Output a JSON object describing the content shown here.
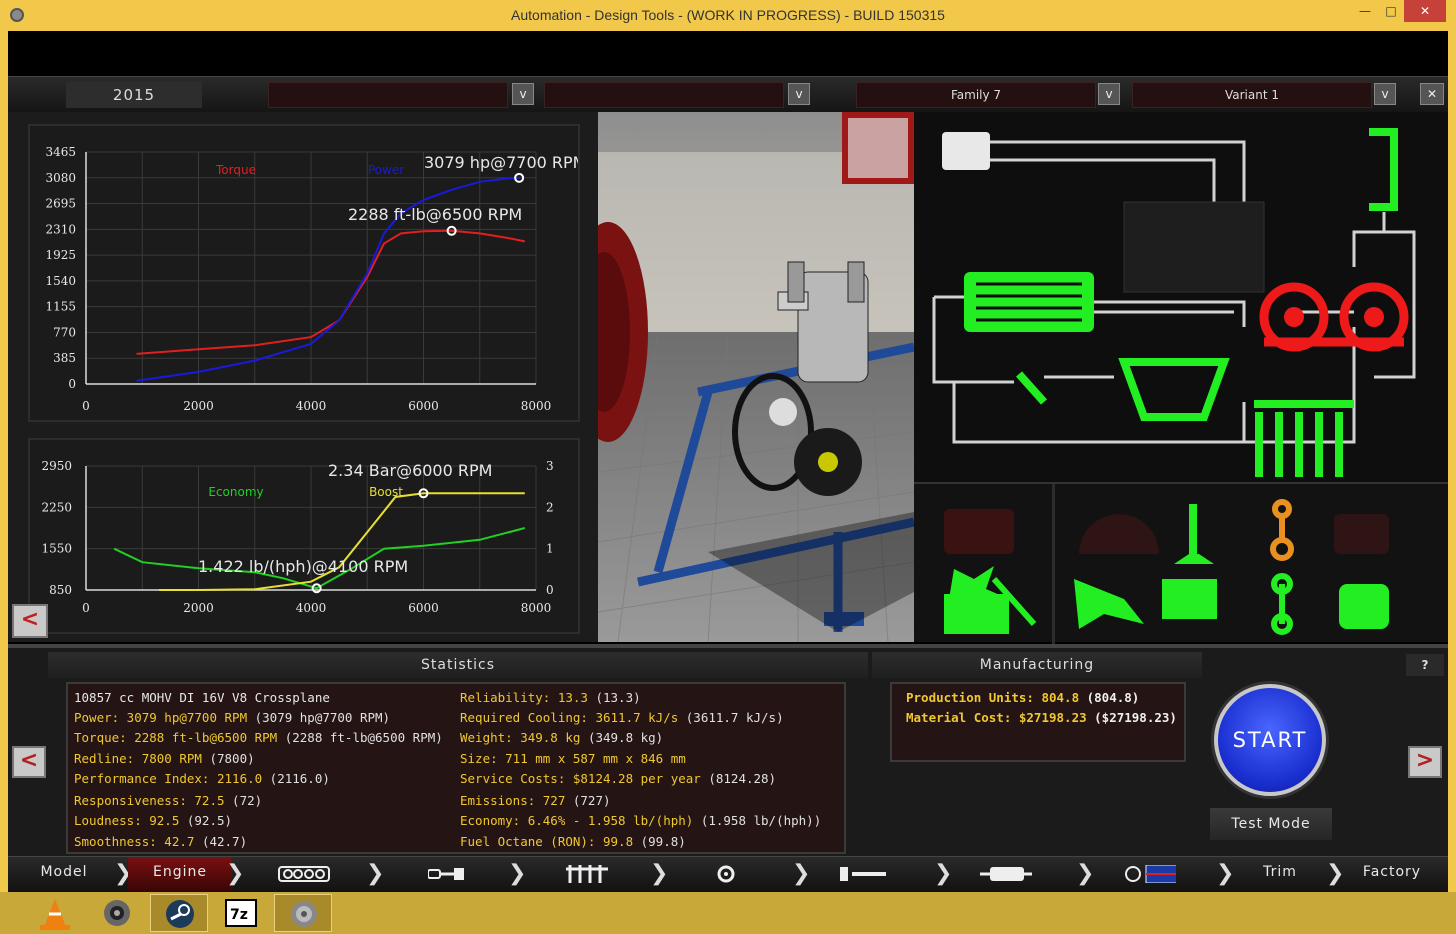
{
  "window": {
    "title": "Automation - Design Tools - (WORK IN PROGRESS) - BUILD 150315",
    "min": "—",
    "max": "□",
    "close": "✕"
  },
  "topbar": {
    "year": "2015",
    "dropdown1": "",
    "dropdown2": "",
    "family": "Family 7",
    "variant": "Variant 1",
    "dd_glyph": "v",
    "close_glyph": "✕"
  },
  "graph_top": {
    "yticks": [
      "3465",
      "3080",
      "2695",
      "2310",
      "1925",
      "1540",
      "1155",
      "770",
      "385",
      "0"
    ],
    "xticks": [
      "0",
      "2000",
      "4000",
      "6000",
      "8000"
    ],
    "torque_label": "Torque",
    "power_label": "Power",
    "power_peak": "3079 hp@7700 RPM",
    "torque_peak": "2288 ft-lb@6500 RPM"
  },
  "graph_bottom": {
    "yticks_left": [
      "2950",
      "2250",
      "1550",
      "850"
    ],
    "yticks_right": [
      "3",
      "2",
      "1",
      "0"
    ],
    "xticks": [
      "0",
      "2000",
      "4000",
      "6000",
      "8000"
    ],
    "economy_label": "Economy",
    "boost_label": "Boost",
    "boost_peak": "2.34 Bar@6000 RPM",
    "economy_min": "1.422 lb/(hph)@4100 RPM"
  },
  "chart_data": [
    {
      "type": "line",
      "xlim": [
        0,
        8000
      ],
      "ylim": [
        0,
        3465
      ],
      "series": [
        {
          "name": "Torque",
          "color": "#e02020",
          "x": [
            900,
            2000,
            3000,
            4000,
            4500,
            5000,
            5300,
            5600,
            6000,
            6500,
            7000,
            7500,
            7800
          ],
          "values": [
            450,
            520,
            580,
            700,
            950,
            1600,
            2100,
            2250,
            2280,
            2288,
            2250,
            2180,
            2130
          ]
        },
        {
          "name": "Power",
          "color": "#1a1adc",
          "x": [
            900,
            2000,
            3000,
            4000,
            4500,
            5000,
            5300,
            5600,
            6000,
            6500,
            7000,
            7500,
            7700
          ],
          "values": [
            50,
            180,
            350,
            600,
            950,
            1650,
            2250,
            2550,
            2750,
            2900,
            3020,
            3070,
            3079
          ]
        }
      ]
    },
    {
      "type": "line",
      "xlim": [
        0,
        8000
      ],
      "ylim_left": [
        850,
        2950
      ],
      "ylim_right": [
        0,
        3
      ],
      "series": [
        {
          "name": "Economy",
          "color": "#22d022",
          "axis": "left",
          "x": [
            500,
            1000,
            2000,
            3000,
            3500,
            4100,
            4700,
            5300,
            6000,
            7000,
            7800
          ],
          "values": [
            1550,
            1320,
            1220,
            1150,
            1050,
            880,
            1200,
            1550,
            1600,
            1700,
            1900
          ]
        },
        {
          "name": "Boost",
          "color": "#e8e030",
          "axis": "right",
          "x": [
            1300,
            2000,
            3000,
            4000,
            4500,
            5000,
            5500,
            6000,
            7000,
            7800
          ],
          "values": [
            0,
            0,
            0.02,
            0.2,
            0.55,
            1.4,
            2.25,
            2.34,
            2.34,
            2.34
          ]
        }
      ]
    }
  ],
  "statistics": {
    "header": "Statistics",
    "left": [
      {
        "k": "10857 cc MOHV DI 16V V8 Crossplane",
        "v": ""
      },
      {
        "k": "Power: 3079 hp@7700 RPM",
        "v": " (3079 hp@7700 RPM)"
      },
      {
        "k": "Torque: 2288 ft-lb@6500 RPM",
        "v": " (2288 ft-lb@6500 RPM)"
      },
      {
        "k": "Redline: 7800 RPM",
        "v": " (7800)"
      },
      {
        "k": "Performance Index: 2116.0",
        "v": " (2116.0)"
      },
      {
        "k": "Responsiveness: 72.5",
        "v": " (72)"
      },
      {
        "k": "Loudness: 92.5",
        "v": " (92.5)"
      },
      {
        "k": "Smoothness: 42.7",
        "v": " (42.7)"
      }
    ],
    "right": [
      {
        "k": "Reliability: 13.3",
        "v": " (13.3)"
      },
      {
        "k": "Required Cooling: 3611.7 kJ/s",
        "v": " (3611.7 kJ/s)"
      },
      {
        "k": "Weight: 349.8 kg",
        "v": " (349.8 kg)"
      },
      {
        "k": "Size: 711 mm x 587 mm x 846 mm",
        "v": ""
      },
      {
        "k": "Service Costs: $8124.28 per year",
        "v": " (8124.28)"
      },
      {
        "k": "Emissions: 727",
        "v": " (727)"
      },
      {
        "k": "Economy: 6.46% - 1.958 lb/(hph)",
        "v": " (1.958 lb/(hph))"
      },
      {
        "k": "Fuel Octane (RON): 99.8",
        "v": " (99.8)"
      }
    ]
  },
  "manufacturing": {
    "header": "Manufacturing",
    "production_units": "Production Units: 804.8",
    "production_units_v": " (804.8)",
    "material_cost": "Material Cost: $27198.23",
    "material_cost_v": " ($27198.23)"
  },
  "controls": {
    "help": "?",
    "start": "START",
    "test_mode": "Test Mode",
    "prev": "<",
    "next": ">"
  },
  "nav": {
    "model": "Model",
    "engine": "Engine",
    "trim": "Trim",
    "factory": "Factory",
    "chev": "❯"
  },
  "colors": {
    "accent_yellow": "#f0c830",
    "schematic_green": "#22ee22",
    "schematic_red": "#ee1a1a",
    "nav_active": "#7a1010",
    "start_blue": "#1a2fd0",
    "taskbar": "#c9a83a"
  }
}
